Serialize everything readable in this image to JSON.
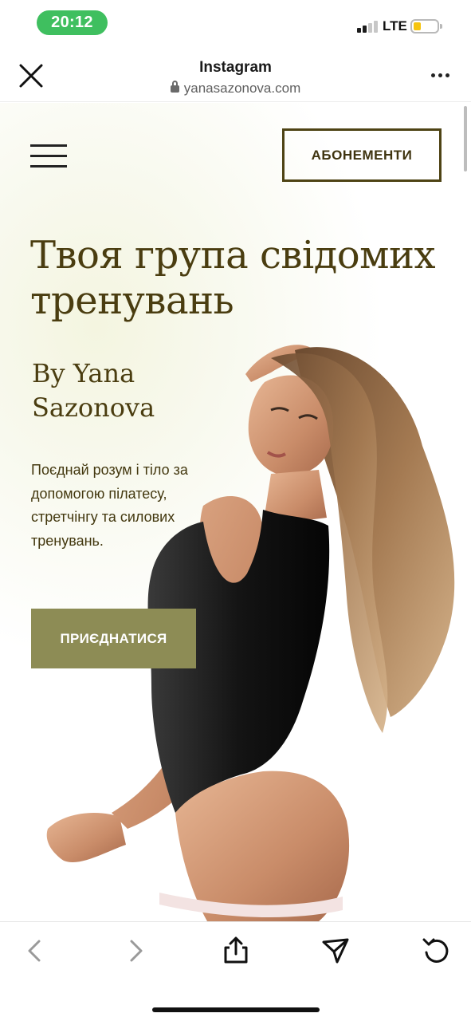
{
  "status_bar": {
    "time": "20:12",
    "network": "LTE",
    "signal_bars": 2,
    "battery_level": 0.25,
    "time_pill_color": "#3fbf5f"
  },
  "browser": {
    "title": "Instagram",
    "url": "yanasazonova.com",
    "close_icon": "close-icon",
    "more_icon": "more-dots-icon"
  },
  "site": {
    "menu_icon": "hamburger-menu-icon",
    "subscriptions_button": "АБОНЕМЕНТИ",
    "hero_title": "Твоя група свідомих тренувань",
    "hero_byline": "By Yana Sazonova",
    "hero_description": "Поєднай розум і тіло за допомогою пілатесу, стретчінгу та силових тренувань.",
    "join_button": "ПРИЄДНАТИСЯ",
    "accent_color": "#8d8c55",
    "text_color": "#4a3d10"
  },
  "toolbar": {
    "back_icon": "back-arrow-icon",
    "forward_icon": "forward-arrow-icon",
    "share_icon": "share-icon",
    "send_icon": "send-icon",
    "reload_icon": "reload-icon"
  }
}
